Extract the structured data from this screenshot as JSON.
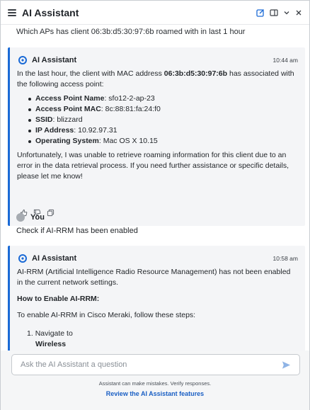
{
  "header": {
    "title": "AI Assistant"
  },
  "conversation": {
    "previous_user_message": "Which APs has client 06:3b:d5:30:97:6b roamed with in last 1 hour",
    "message1": {
      "sender": "AI Assistant",
      "time": "10:44 am",
      "intro_prefix": "In the last hour, the client with MAC address ",
      "intro_mac": "06:3b:d5:30:97:6b",
      "intro_suffix": " has associated with the following access point:",
      "details": [
        {
          "label": "Access Point Name",
          "value": ": sfo12-2-ap-23"
        },
        {
          "label": "Access Point MAC",
          "value": ": 8c:88:81:fa:24:f0"
        },
        {
          "label": "SSID",
          "value": ": blizzard"
        },
        {
          "label": "IP Address",
          "value": ": 10.92.97.31"
        },
        {
          "label": "Operating System",
          "value": ": Mac OS X 10.15"
        }
      ],
      "closing": "Unfortunately, I was unable to retrieve roaming information for this client due to an error in the data retrieval process. If you need further assistance or specific details, please let me know!"
    },
    "user_message": {
      "sender": "You",
      "text": "Check if AI-RRM has been enabled"
    },
    "message2": {
      "sender": "AI Assistant",
      "time": "10:58 am",
      "intro": "AI-RRM (Artificial Intelligence Radio Resource Management) has not been enabled in the current network settings.",
      "heading": "How to Enable AI-RRM:",
      "steps_intro": "To enable AI-RRM in Cisco Meraki, follow these steps:",
      "step1_number": "1.",
      "step1_text": "Navigate to",
      "step1_bold": "Wireless"
    }
  },
  "composer": {
    "placeholder": "Ask the AI Assistant a question",
    "disclaimer": "Assistant can make mistakes. Verify responses.",
    "review_link": "Review the AI Assistant features"
  },
  "colors": {
    "accent": "#1a6ad6",
    "link": "#1a5fc4",
    "bubble_bg": "#f4f5f7"
  }
}
